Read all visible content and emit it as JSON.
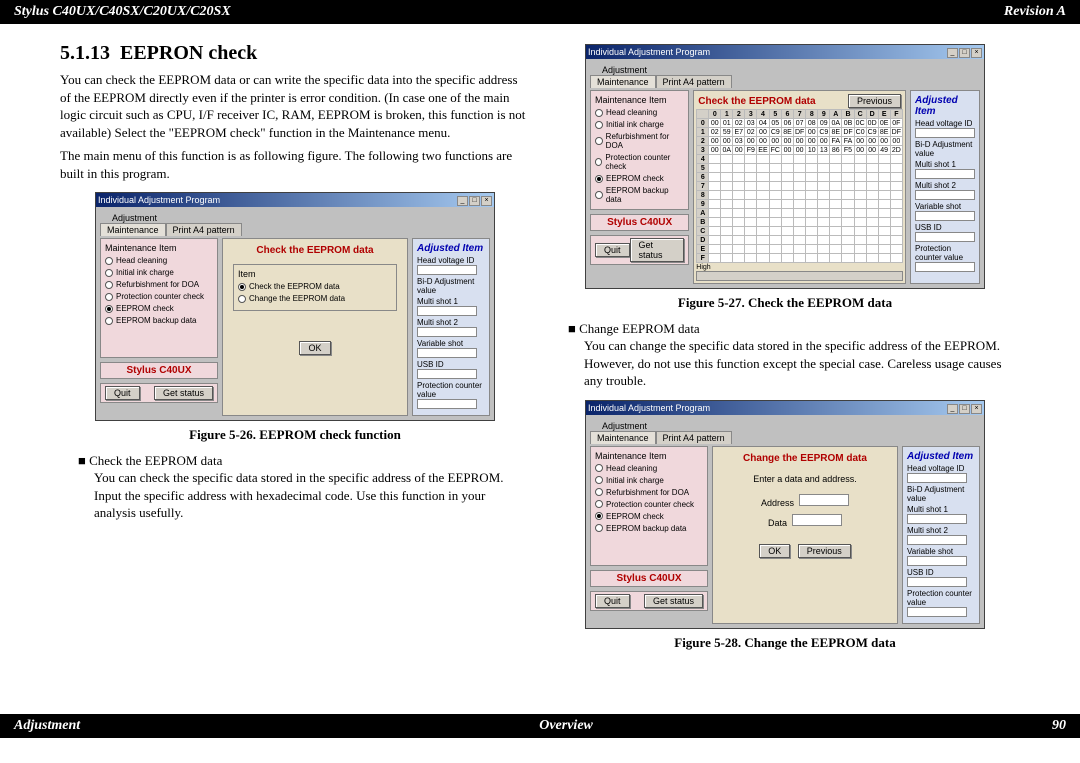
{
  "header": {
    "left": "Stylus C40UX/C40SX/C20UX/C20SX",
    "right": "Revision A"
  },
  "footer": {
    "left": "Adjustment",
    "center": "Overview",
    "right": "90"
  },
  "section": {
    "number": "5.1.13",
    "title": "EEPRON check"
  },
  "para1": "You can check the EEPROM data or can write the specific data into the specific address of the EEPROM directly even if the printer is error condition. (In case one of the main logic circuit such as CPU, I/F receiver IC, RAM, EEPROM is broken, this function is not available) Select the \"EEPROM check\" function in the Maintenance menu.",
  "para2": "The main menu of this function is as following figure. The following two functions are built in this program.",
  "fig26": {
    "caption": "Figure 5-26.  EEPROM check function"
  },
  "bullet1": {
    "title": "Check the EEPROM data",
    "desc": "You can check the specific data stored in the specific address of the EEPROM.\nInput the specific address with hexadecimal code. Use this function in your analysis usefully."
  },
  "fig27": {
    "caption": "Figure 5-27.  Check the EEPROM data"
  },
  "bullet2": {
    "title": "Change EEPROM data",
    "desc": "You can change the specific data stored in the specific address of the EEPROM.\nHowever, do not use this function except the special case. Careless usage causes any trouble."
  },
  "fig28": {
    "caption": "Figure 5-28.  Change the EEPROM data"
  },
  "win": {
    "title": "Individual Adjustment Program",
    "adj_label": "Adjustment",
    "tab_maint": "Maintenance",
    "tab_print": "Print A4 pattern",
    "maint_legend": "Maintenance Item",
    "items": {
      "head_cleaning": "Head cleaning",
      "initial_ink": "Initial ink charge",
      "refurb": "Refurbishment for DOA",
      "prot_counter": "Protection counter check",
      "eeprom_check": "EEPROM check",
      "eeprom_backup": "EEPROM backup data"
    },
    "model": "Stylus C40UX",
    "quit": "Quit",
    "get_status": "Get status",
    "check_title": "Check the EEPROM data",
    "change_title": "Change the EEPROM data",
    "item_legend": "Item",
    "opt_check": "Check the EEPROM data",
    "opt_change": "Change the EEPROM data",
    "ok": "OK",
    "previous": "Previous",
    "enter_prompt": "Enter a data and address.",
    "address_label": "Address",
    "data_label": "Data",
    "adjusted": "Adjusted Item",
    "side": {
      "head_v": "Head voltage ID",
      "bid": "Bi-D Adjustment value",
      "ms1": "Multi shot 1",
      "ms2": "Multi shot 2",
      "vs": "Variable shot",
      "usb": "USB ID",
      "pcv": "Protection counter value"
    }
  },
  "hex": {
    "cols": [
      "0",
      "1",
      "2",
      "3",
      "4",
      "5",
      "6",
      "7",
      "8",
      "9",
      "A",
      "B",
      "C",
      "D",
      "E",
      "F"
    ],
    "rows": [
      [
        "0",
        "00",
        "01",
        "02",
        "03",
        "04",
        "05",
        "06",
        "07",
        "08",
        "09",
        "0A",
        "0B",
        "0C",
        "0D",
        "0E",
        "0F"
      ],
      [
        "1",
        "02",
        "59",
        "E7",
        "02",
        "00",
        "C9",
        "8E",
        "DF",
        "00",
        "C9",
        "8E",
        "DF",
        "C0",
        "C9",
        "8E",
        "DF"
      ],
      [
        "2",
        "00",
        "00",
        "03",
        "00",
        "00",
        "00",
        "00",
        "00",
        "00",
        "00",
        "FA",
        "FA",
        "00",
        "00",
        "00",
        "00"
      ],
      [
        "3",
        "00",
        "0A",
        "00",
        "F9",
        "EE",
        "FC",
        "00",
        "00",
        "10",
        "13",
        "86",
        "F5",
        "00",
        "00",
        "49",
        "2D"
      ],
      [
        "4",
        "",
        "",
        "",
        "",
        "",
        "",
        "",
        "",
        "",
        "",
        "",
        "",
        "",
        "",
        "",
        ""
      ],
      [
        "5",
        "",
        "",
        "",
        "",
        "",
        "",
        "",
        "",
        "",
        "",
        "",
        "",
        "",
        "",
        "",
        ""
      ],
      [
        "6",
        "",
        "",
        "",
        "",
        "",
        "",
        "",
        "",
        "",
        "",
        "",
        "",
        "",
        "",
        "",
        ""
      ],
      [
        "7",
        "",
        "",
        "",
        "",
        "",
        "",
        "",
        "",
        "",
        "",
        "",
        "",
        "",
        "",
        "",
        ""
      ],
      [
        "8",
        "",
        "",
        "",
        "",
        "",
        "",
        "",
        "",
        "",
        "",
        "",
        "",
        "",
        "",
        "",
        ""
      ],
      [
        "9",
        "",
        "",
        "",
        "",
        "",
        "",
        "",
        "",
        "",
        "",
        "",
        "",
        "",
        "",
        "",
        ""
      ],
      [
        "A",
        "",
        "",
        "",
        "",
        "",
        "",
        "",
        "",
        "",
        "",
        "",
        "",
        "",
        "",
        "",
        ""
      ],
      [
        "B",
        "",
        "",
        "",
        "",
        "",
        "",
        "",
        "",
        "",
        "",
        "",
        "",
        "",
        "",
        "",
        ""
      ],
      [
        "C",
        "",
        "",
        "",
        "",
        "",
        "",
        "",
        "",
        "",
        "",
        "",
        "",
        "",
        "",
        "",
        ""
      ],
      [
        "D",
        "",
        "",
        "",
        "",
        "",
        "",
        "",
        "",
        "",
        "",
        "",
        "",
        "",
        "",
        "",
        ""
      ],
      [
        "E",
        "",
        "",
        "",
        "",
        "",
        "",
        "",
        "",
        "",
        "",
        "",
        "",
        "",
        "",
        "",
        ""
      ],
      [
        "F",
        "",
        "",
        "",
        "",
        "",
        "",
        "",
        "",
        "",
        "",
        "",
        "",
        "",
        "",
        "",
        ""
      ]
    ],
    "high": "High"
  }
}
